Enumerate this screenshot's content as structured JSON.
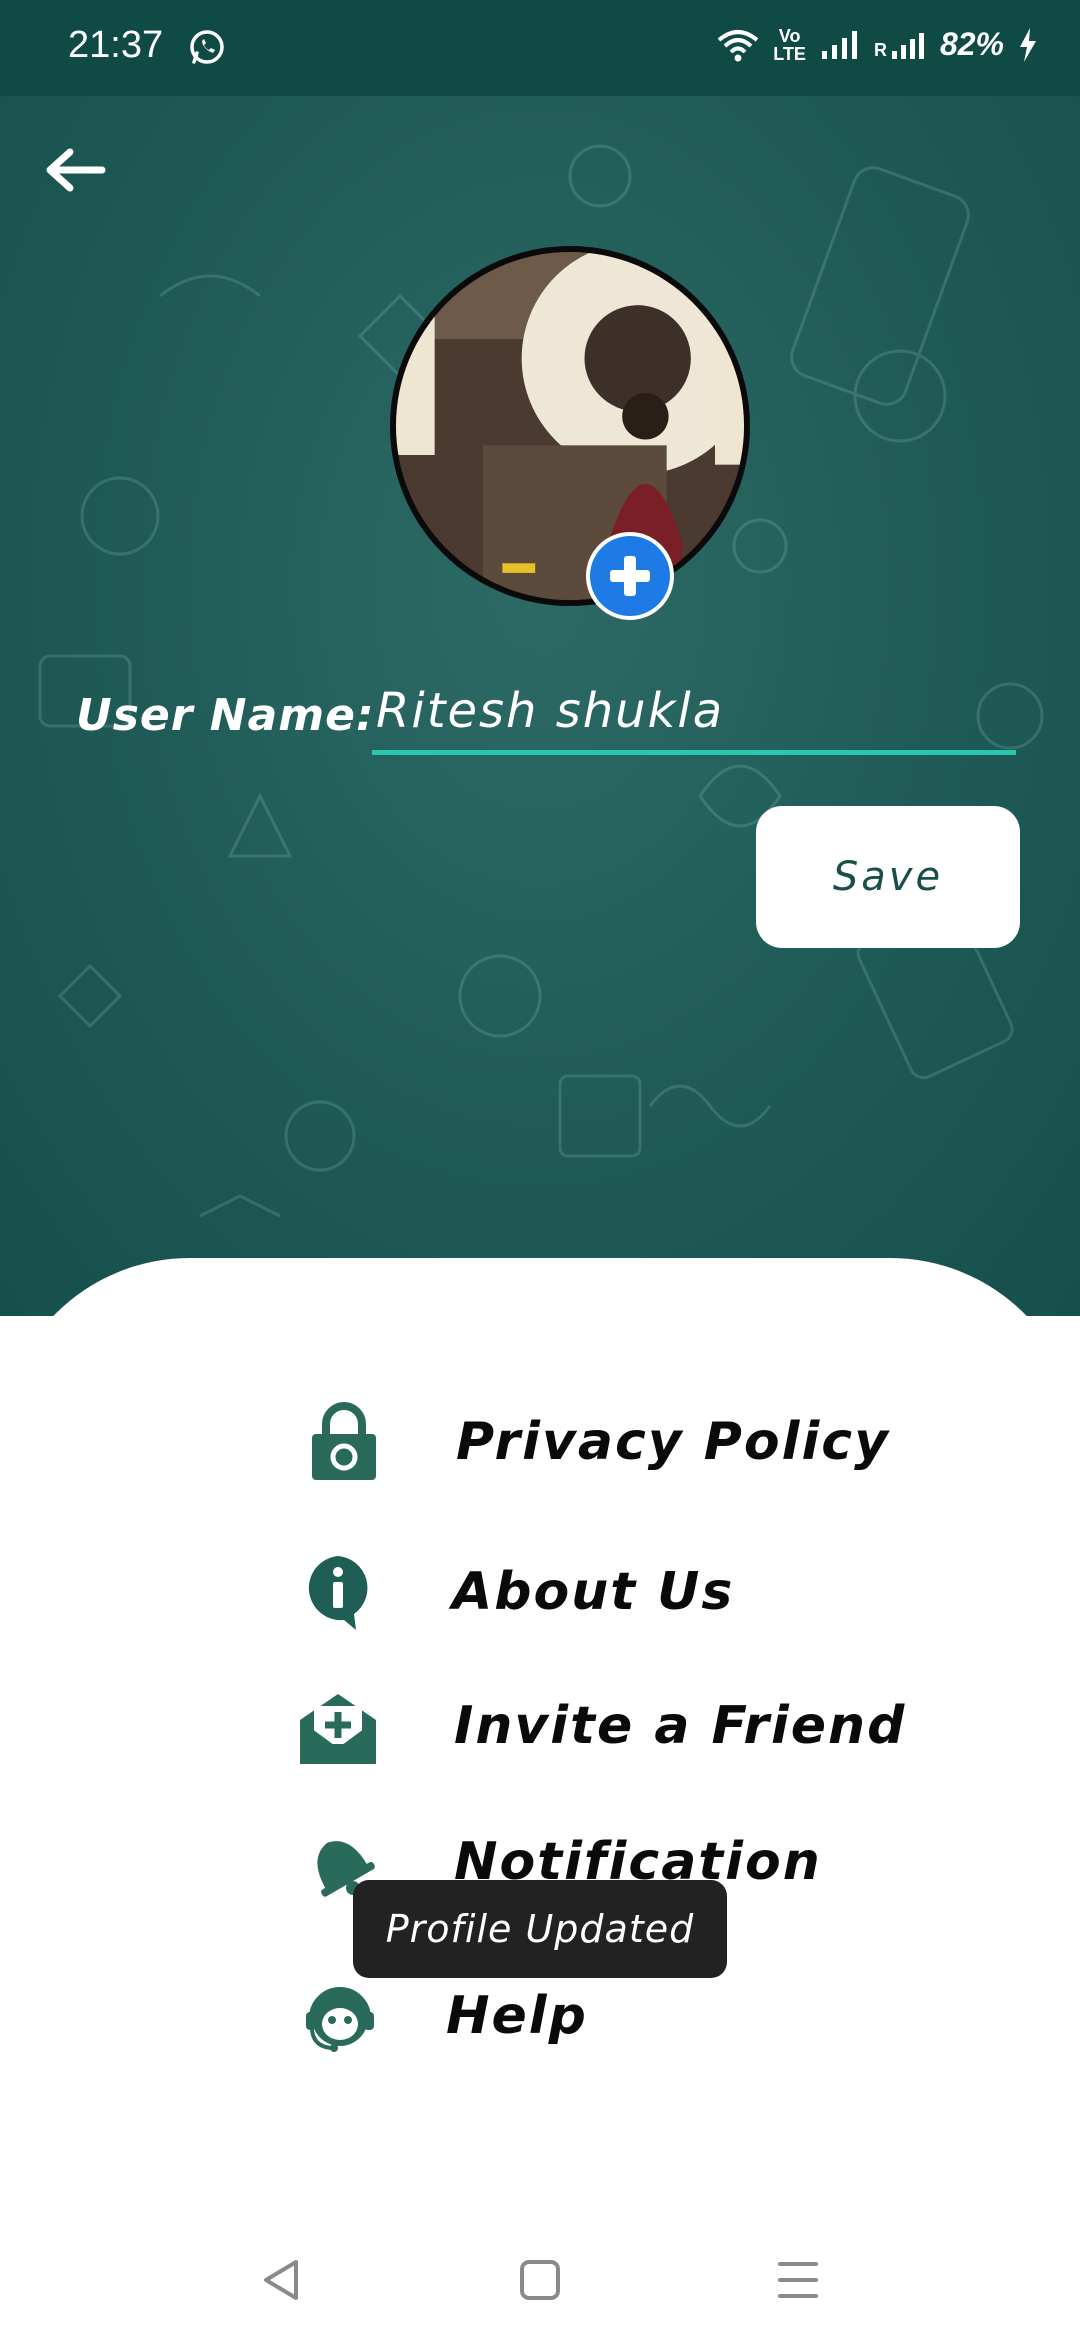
{
  "status_bar": {
    "time": "21:37",
    "volte_top": "Vo",
    "volte_bottom": "LTE",
    "roaming": "R",
    "battery": "82%",
    "icons": [
      "whatsapp-icon",
      "wifi-icon",
      "signal-icon",
      "charging-icon"
    ]
  },
  "colors": {
    "header_bg": "#0f4a44",
    "background": "#1f5a56",
    "accent": "#28c7b0",
    "add_button": "#1e7be6",
    "menu_icon": "#2a6a5a"
  },
  "profile": {
    "username_label": "User Name:",
    "username_value": "Ritesh shukla",
    "save_label": "Save"
  },
  "menu": {
    "items": [
      {
        "label": "Privacy Policy",
        "icon": "lock-icon"
      },
      {
        "label": "About Us",
        "icon": "info-icon"
      },
      {
        "label": "Invite a Friend",
        "icon": "mail-add-icon"
      },
      {
        "label": "Notification",
        "icon": "bell-icon"
      },
      {
        "label": "Help",
        "icon": "support-icon"
      }
    ]
  },
  "toast": {
    "text": "Profile Updated"
  },
  "nav": [
    "back-nav-icon",
    "home-nav-icon",
    "menu-nav-icon"
  ]
}
